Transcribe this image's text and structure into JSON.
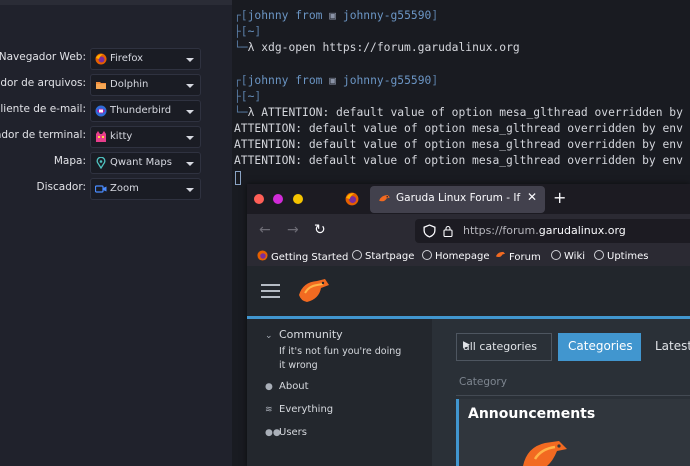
{
  "settings": {
    "rows": [
      {
        "label": "Navegador Web:",
        "value": "Firefox",
        "icon": "firefox-icon"
      },
      {
        "label": "ciador de arquivos:",
        "value": "Dolphin",
        "icon": "dolphin-icon"
      },
      {
        "label": "Cliente de e-mail:",
        "value": "Thunderbird",
        "icon": "thunderbird-icon"
      },
      {
        "label": "ulador de terminal:",
        "value": "kitty",
        "icon": "kitty-icon"
      },
      {
        "label": "Mapa:",
        "value": "Qwant Maps",
        "icon": "map-pin-icon"
      },
      {
        "label": "Discador:",
        "value": "Zoom",
        "icon": "video-camera-icon"
      }
    ]
  },
  "terminal": {
    "user": "johnny",
    "from_word": "from",
    "host": "johnny-g55590",
    "cwd": "~",
    "prompt_symbol": "λ",
    "command1": "xdg-open https://forum.garudalinux.org",
    "output_first": "ATTENTION: default value of option mesa_glthread overridden by",
    "output_lines": [
      "ATTENTION: default value of option mesa_glthread overridden by env",
      "ATTENTION: default value of option mesa_glthread overridden by env",
      "ATTENTION: default value of option mesa_glthread overridden by env"
    ]
  },
  "browser": {
    "tab_title": "Garuda Linux Forum - If it's",
    "tab_close": "✕",
    "new_tab": "+",
    "url_prefix": "https://forum.",
    "url_domain": "garudalinux.org",
    "bookmarks": [
      "Getting Started",
      "Startpage",
      "Homepage",
      "Forum",
      "Wiki",
      "Uptimes"
    ]
  },
  "forum": {
    "community": "Community",
    "tagline": "If it's not fun you're doing it wrong",
    "side_items": [
      "About",
      "Everything",
      "Users"
    ],
    "all_categories": "all categories",
    "categories_btn": "Categories",
    "latest": "Latest",
    "category_header": "Category",
    "announcements": "Announcements"
  },
  "colors": {
    "accent": "#4196cf",
    "terminal_user": "#6b95c4",
    "close_dot": "#ff5f57",
    "min_dot": "#d12bd8",
    "max_dot": "#f5c400"
  }
}
